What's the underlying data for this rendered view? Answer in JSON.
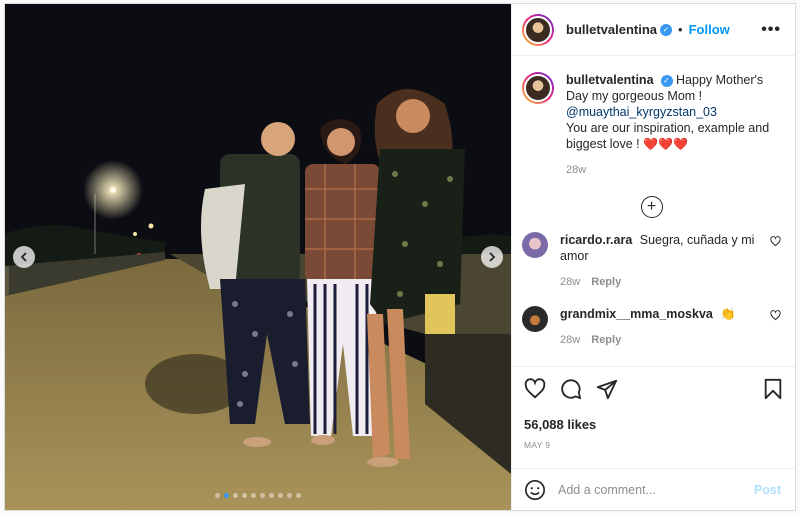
{
  "post": {
    "author": "bulletvalentina",
    "follow_label": "Follow",
    "bullet": "•",
    "more_label": "•••",
    "caption": {
      "user": "bulletvalentina",
      "line1": "Happy Mother's Day my gorgeous Mom !",
      "mention": "@muaythai_kyrgyzstan_03",
      "line2": "You are our inspiration, example and biggest love !",
      "hearts": "❤️❤️❤️",
      "age": "28w"
    },
    "load_more_label": "+",
    "comments": [
      {
        "user": "ricardo.r.ara",
        "text": "Suegra, cuñada y mi amor",
        "age": "28w",
        "reply_label": "Reply"
      },
      {
        "user": "grandmix__mma_moskva",
        "text": "👏",
        "age": "28w",
        "reply_label": "Reply"
      }
    ],
    "likes": "56,088 likes",
    "date": "MAY 9",
    "add_comment_placeholder": "Add a comment...",
    "post_label": "Post",
    "carousel": {
      "slides": 10,
      "active_index": 1
    }
  },
  "colors": {
    "accent": "#0095f6",
    "verified": "#3897f0",
    "heart": "#ed4956",
    "post_disabled": "#b2dffc"
  },
  "icons": [
    "verified-badge-icon",
    "more-options-icon",
    "like-icon",
    "comment-icon",
    "share-icon",
    "save-icon",
    "emoji-icon",
    "load-more-icon",
    "comment-like-icon",
    "prev-arrow-icon",
    "next-arrow-icon"
  ]
}
